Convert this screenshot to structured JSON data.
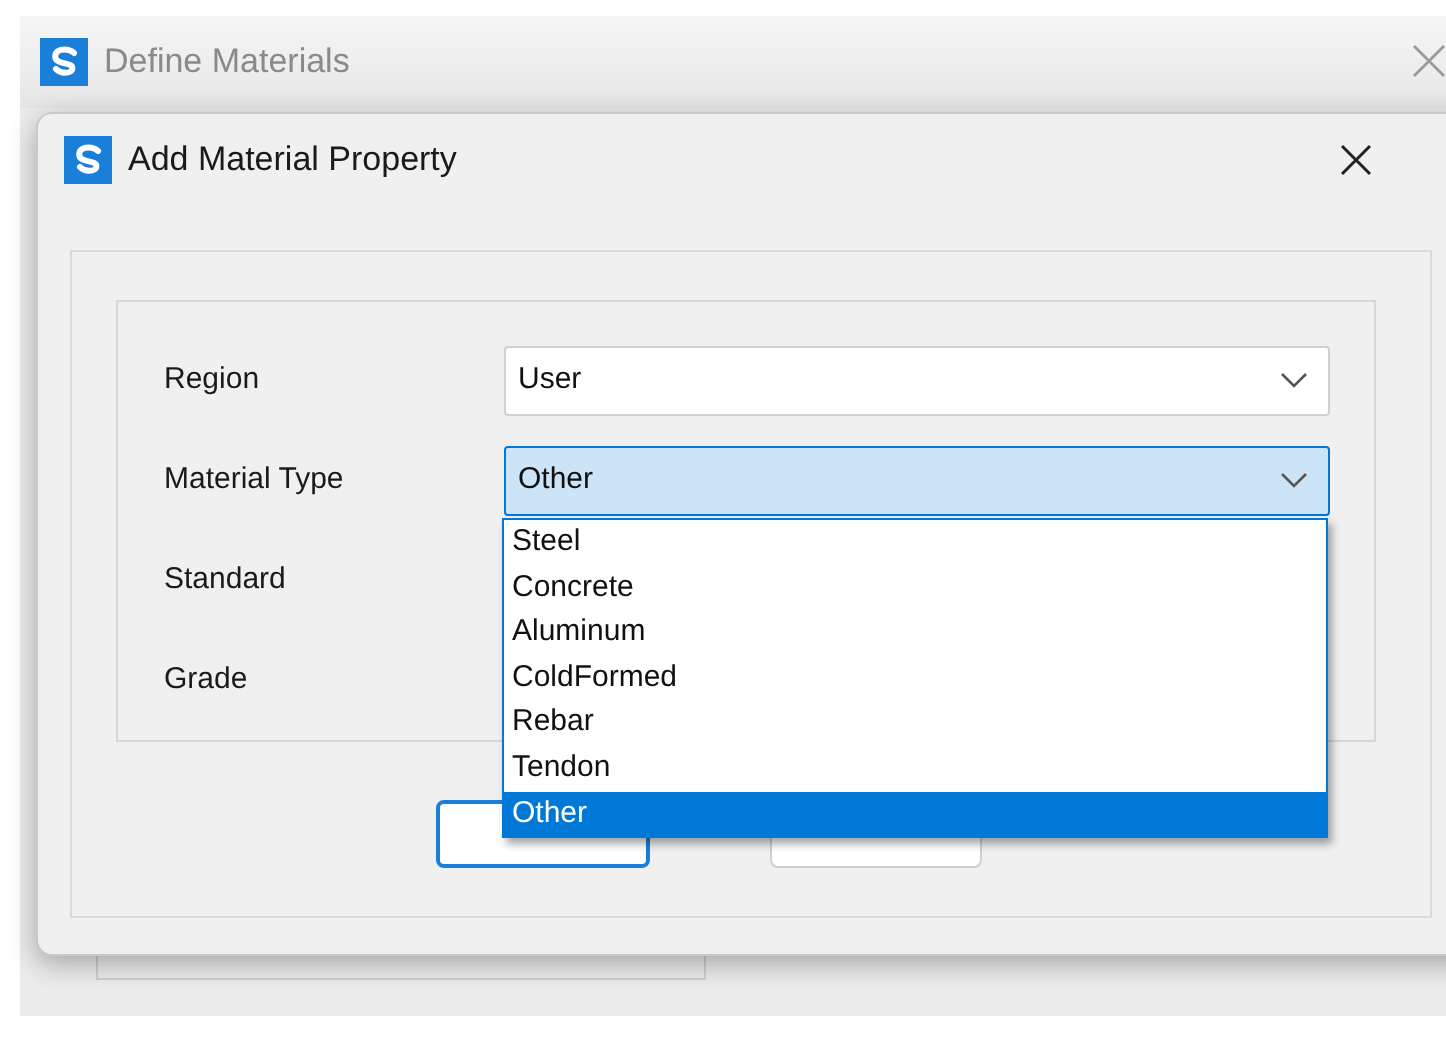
{
  "background_window": {
    "title": "Define Materials"
  },
  "dialog": {
    "title": "Add Material Property",
    "fields": [
      {
        "label": "Region",
        "value": "User",
        "focused": false
      },
      {
        "label": "Material Type",
        "value": "Other",
        "focused": true
      },
      {
        "label": "Standard"
      },
      {
        "label": "Grade"
      }
    ],
    "dropdown": [
      {
        "label": "Steel",
        "selected": false
      },
      {
        "label": "Concrete",
        "selected": false
      },
      {
        "label": "Aluminum",
        "selected": false
      },
      {
        "label": "ColdFormed",
        "selected": false
      },
      {
        "label": "Rebar",
        "selected": false
      },
      {
        "label": "Tendon",
        "selected": false
      },
      {
        "label": "Other",
        "selected": true
      }
    ]
  }
}
